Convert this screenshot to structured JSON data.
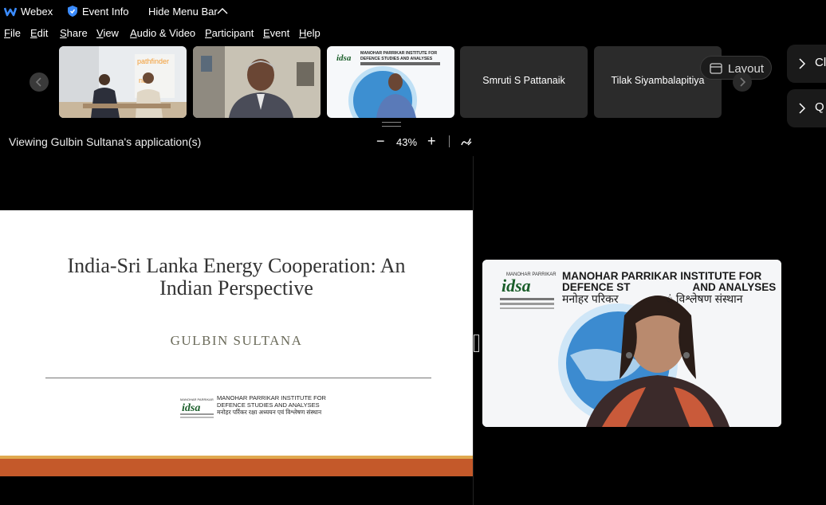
{
  "topbar": {
    "app_name": "Webex",
    "event_info": "Event Info",
    "hide_menu_bar": "Hide Menu Bar"
  },
  "menubar": {
    "items": [
      {
        "label": "File",
        "underline": "F",
        "rest": "ile"
      },
      {
        "label": "Edit",
        "underline": "E",
        "rest": "dit"
      },
      {
        "label": "Share",
        "underline": "S",
        "rest": "hare"
      },
      {
        "label": "View",
        "underline": "V",
        "rest": "iew"
      },
      {
        "label": "Audio & Video",
        "underline": "A",
        "rest": "udio & Video"
      },
      {
        "label": "Participant",
        "underline": "P",
        "rest": "articipant"
      },
      {
        "label": "Event",
        "underline": "E",
        "rest": "vent"
      },
      {
        "label": "Help",
        "underline": "H",
        "rest": "elp"
      }
    ]
  },
  "participants": {
    "name_tiles": [
      "Smruti S Pattanaik",
      "Tilak Siyambalapitiya"
    ]
  },
  "layout_button": "Layout",
  "side_panels": [
    "Cl",
    "Q"
  ],
  "share": {
    "viewing_label": "Viewing Gulbin Sultana's application(s)",
    "zoom_level": "43%",
    "zoom_out": "−",
    "zoom_in": "+"
  },
  "slide": {
    "title_line1": "India-Sri Lanka Energy Cooperation: An",
    "title_line2": "Indian Perspective",
    "author": "GULBIN SULTANA",
    "logo_text_line1": "MANOHAR PARRIKAR INSTITUTE FOR",
    "logo_text_line2": "DEFENCE STUDIES AND ANALYSES",
    "logo_text_line3": "मनोहर पर्रिकर रक्षा अध्ययन एवं विश्लेषण संस्थान"
  },
  "speaker_banner": {
    "line1": "MANOHAR PARRIKAR INSTITUTE FOR",
    "line2": "DEFENCE ST",
    "line2b": "AND ANALYSES",
    "line3": "मनोहर परिकर",
    "line3b": "ं विश्लेषण संस्थान"
  },
  "colors": {
    "accent_orange": "#c4592a",
    "webex_blue": "#3b8cff"
  }
}
